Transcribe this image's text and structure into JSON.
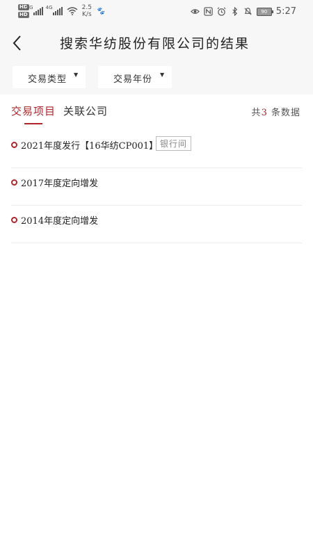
{
  "status_bar": {
    "net_type": "4G",
    "net_type_2": "5G",
    "speed_value": "2.5",
    "speed_unit": "K/s",
    "battery": "90",
    "time": "5:27"
  },
  "header": {
    "title": "搜索华纺股份有限公司的结果"
  },
  "filters": {
    "type_label": "交易类型",
    "year_label": "交易年份"
  },
  "tabs": [
    {
      "label": "交易项目"
    },
    {
      "label": "关联公司"
    }
  ],
  "result_count": {
    "prefix": "共",
    "number": "3",
    "suffix": "条数据"
  },
  "results": [
    {
      "title": "2021年度发行【16华纺CP001】",
      "tag": "银行间"
    },
    {
      "title": "2017年度定向增发"
    },
    {
      "title": "2014年度定向增发"
    }
  ],
  "colors": {
    "accent": "#b0242a",
    "page_bg": "#f7f7f7"
  }
}
